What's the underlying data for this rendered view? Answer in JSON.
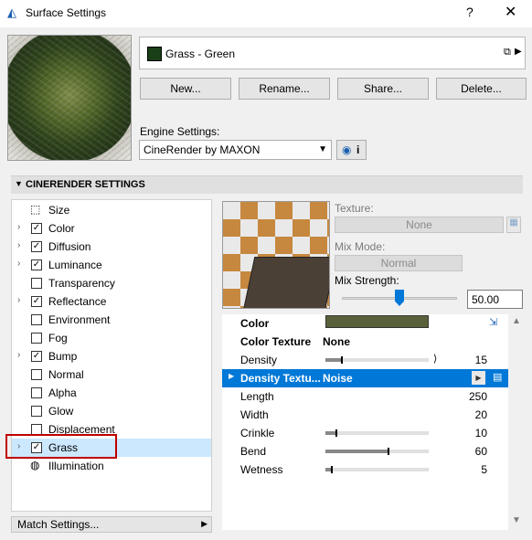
{
  "window": {
    "title": "Surface Settings",
    "help_label": "?",
    "close_label": "✕"
  },
  "surface": {
    "name": "Grass - Green",
    "swatch_color": "#1a4018"
  },
  "buttons": {
    "new": "New...",
    "rename": "Rename...",
    "share": "Share...",
    "delete": "Delete..."
  },
  "engine": {
    "label": "Engine Settings:",
    "value": "CineRender by MAXON",
    "info_label": "i"
  },
  "section": {
    "title": "CINERENDER SETTINGS"
  },
  "channels": [
    {
      "label": "Size",
      "expandable": false,
      "checkbox": null
    },
    {
      "label": "Color",
      "expandable": true,
      "checkbox": true
    },
    {
      "label": "Diffusion",
      "expandable": true,
      "checkbox": true
    },
    {
      "label": "Luminance",
      "expandable": true,
      "checkbox": true
    },
    {
      "label": "Transparency",
      "expandable": false,
      "checkbox": false
    },
    {
      "label": "Reflectance",
      "expandable": true,
      "checkbox": true
    },
    {
      "label": "Environment",
      "expandable": false,
      "checkbox": false
    },
    {
      "label": "Fog",
      "expandable": false,
      "checkbox": false
    },
    {
      "label": "Bump",
      "expandable": true,
      "checkbox": true
    },
    {
      "label": "Normal",
      "expandable": false,
      "checkbox": false
    },
    {
      "label": "Alpha",
      "expandable": false,
      "checkbox": false
    },
    {
      "label": "Glow",
      "expandable": false,
      "checkbox": false
    },
    {
      "label": "Displacement",
      "expandable": false,
      "checkbox": false
    },
    {
      "label": "Grass",
      "expandable": true,
      "checkbox": true,
      "selected": true
    },
    {
      "label": "Illumination",
      "expandable": false,
      "checkbox": null
    }
  ],
  "match_settings": {
    "label": "Match Settings..."
  },
  "texture": {
    "label": "Texture:",
    "value": "None",
    "mix_mode_label": "Mix Mode:",
    "mix_mode_value": "Normal",
    "mix_strength_label": "Mix Strength:",
    "mix_strength_value": "50.00",
    "mix_strength_fraction": 0.5
  },
  "properties": [
    {
      "label": "Color",
      "bold": true,
      "type": "color",
      "color": "#59613a"
    },
    {
      "label": "Color Texture",
      "bold": true,
      "type": "text",
      "value": "None"
    },
    {
      "label": "Density",
      "type": "slider",
      "value": "15",
      "fraction": 0.15,
      "link": true
    },
    {
      "label": "Density Textu...",
      "type": "text",
      "value": "Noise",
      "selected": true,
      "bold": true
    },
    {
      "label": "Length",
      "type": "number",
      "value": "250"
    },
    {
      "label": "Width",
      "type": "number",
      "value": "20"
    },
    {
      "label": "Crinkle",
      "type": "slider",
      "value": "10",
      "fraction": 0.1
    },
    {
      "label": "Bend",
      "type": "slider",
      "value": "60",
      "fraction": 0.6
    },
    {
      "label": "Wetness",
      "type": "slider",
      "value": "5",
      "fraction": 0.05
    }
  ]
}
